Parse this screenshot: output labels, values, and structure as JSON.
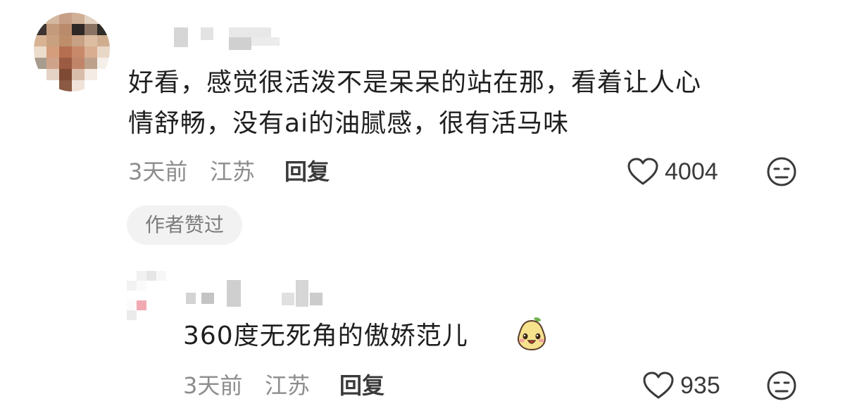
{
  "comments": [
    {
      "text_line1": "好看，感觉很活泼不是呆呆的站在那，看着让人心",
      "text_line2": "情舒畅，没有ai的油腻感，很有活马味",
      "time": "3天前",
      "location": "江苏",
      "reply_label": "回复",
      "likes": "4004",
      "badge": "作者赞过",
      "icons": {
        "like": "heart-outline-icon",
        "dislike": "frown-face-icon"
      }
    },
    {
      "text": "360度无死角的傲娇范儿",
      "sticker": "smiling-pear-sticker",
      "time": "3天前",
      "location": "江苏",
      "reply_label": "回复",
      "likes": "935",
      "icons": {
        "like": "heart-outline-icon",
        "dislike": "frown-face-icon"
      }
    }
  ],
  "colors": {
    "text": "#1f1f1f",
    "meta": "#8d8d8d",
    "badge_bg": "#f2f2f2",
    "icon": "#3a3a3a"
  }
}
